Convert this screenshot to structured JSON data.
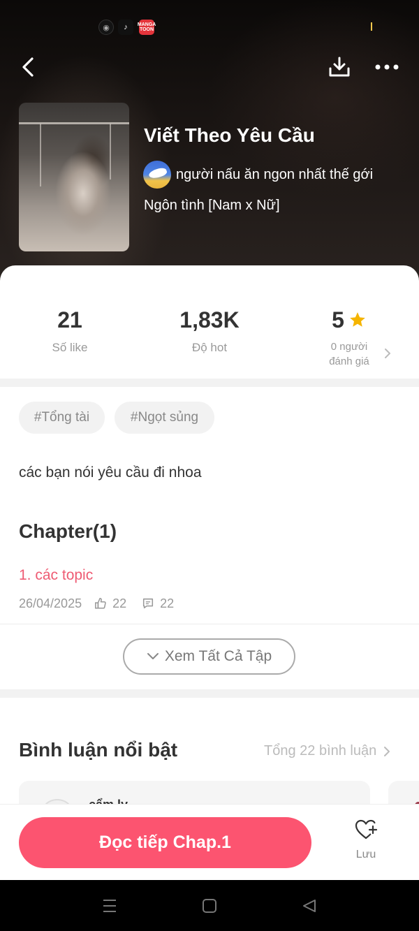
{
  "status_bar": {
    "apps": [
      "tiktok-icon",
      "manga-toon-icon"
    ],
    "manga_toon_text": "MANGA TOON"
  },
  "header": {
    "back": "back-arrow-icon",
    "download": "download-icon",
    "more": "more-dots-icon"
  },
  "book": {
    "title": "Viết Theo Yêu Cầu",
    "author": "người nấu ăn ngon nhất thế gới",
    "genre": "Ngôn tình [Nam x Nữ]"
  },
  "stats": [
    {
      "value": "21",
      "label": "Số like"
    },
    {
      "value": "1,83K",
      "label": "Độ hot"
    },
    {
      "value": "5",
      "label_line1": "0 người",
      "label_line2": "đánh giá"
    }
  ],
  "tags": [
    "#Tổng tài",
    "#Ngọt sủng"
  ],
  "description": "các bạn nói yêu cầu đi nhoa",
  "chapters": {
    "heading": "Chapter(1)",
    "items": [
      {
        "title": "1. các topic",
        "date": "26/04/2025",
        "likes": "22",
        "comments": "22"
      }
    ],
    "view_all": "Xem Tất Cả Tập"
  },
  "comments": {
    "heading": "Bình luận nổi bật",
    "total": "Tổng 22 bình luận",
    "first_user": "cẩm ly"
  },
  "bottom": {
    "read_button": "Đọc tiếp Chap.1",
    "save_label": "Lưu"
  },
  "colors": {
    "accent": "#fc5470",
    "chapter_link": "#ee5b73",
    "star": "#f5b400"
  }
}
